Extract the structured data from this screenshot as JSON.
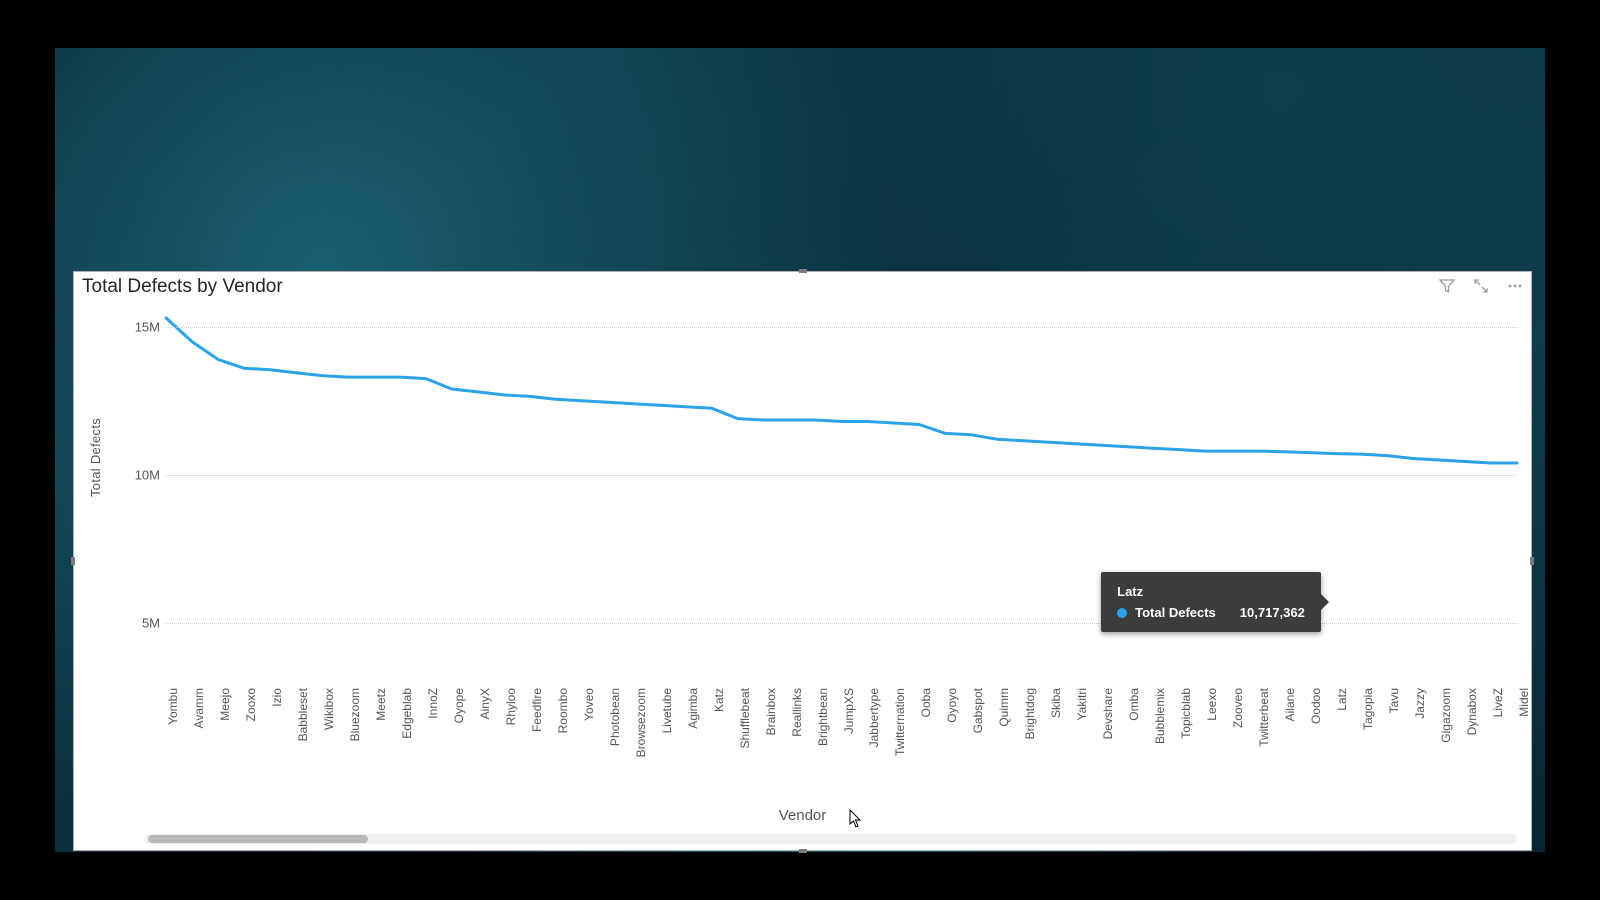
{
  "chart_data": {
    "type": "line",
    "title": "Total Defects by Vendor",
    "xlabel": "Vendor",
    "ylabel": "Total Defects",
    "ylim": [
      3000000,
      15500000
    ],
    "y_ticks": [
      {
        "value": 5000000,
        "label": "5M"
      },
      {
        "value": 10000000,
        "label": "10M"
      },
      {
        "value": 15000000,
        "label": "15M"
      }
    ],
    "categories": [
      "Yombu",
      "Avamm",
      "Meejo",
      "Zooxo",
      "Izio",
      "Babbleset",
      "Wikibox",
      "Bluezoom",
      "Meetz",
      "Edgeblab",
      "InnoZ",
      "Oyope",
      "AinyX",
      "Rhyloo",
      "Feedfire",
      "Roombo",
      "Yoveo",
      "Photobean",
      "Browsezoom",
      "Livetube",
      "Agimba",
      "Katz",
      "Shufflebeat",
      "Brainbox",
      "Reallinks",
      "Brightbean",
      "JumpXS",
      "Jabbertype",
      "Twitternation",
      "Ooba",
      "Oyoyo",
      "Gabspot",
      "Quimm",
      "Brightdog",
      "Skiba",
      "Yakitri",
      "Devshare",
      "Omba",
      "Bubblemix",
      "Topicblab",
      "Leexo",
      "Zooveo",
      "Twitterbeat",
      "Ailane",
      "Oodoo",
      "Latz",
      "Tagopia",
      "Tavu",
      "Jazzy",
      "Gigazoom",
      "Dynabox",
      "LiveZ",
      "Midel"
    ],
    "values": [
      15300000,
      14500000,
      13900000,
      13600000,
      13550000,
      13450000,
      13350000,
      13300000,
      13300000,
      13300000,
      13250000,
      12900000,
      12800000,
      12700000,
      12650000,
      12550000,
      12500000,
      12450000,
      12400000,
      12350000,
      12300000,
      12250000,
      11900000,
      11850000,
      11850000,
      11850000,
      11800000,
      11800000,
      11750000,
      11700000,
      11400000,
      11350000,
      11200000,
      11150000,
      11100000,
      11050000,
      11000000,
      10950000,
      10900000,
      10850000,
      10800000,
      10800000,
      10800000,
      10780000,
      10750000,
      10717362,
      10700000,
      10650000,
      10550000,
      10500000,
      10450000,
      10400000,
      10400000
    ],
    "series_name": "Total Defects"
  },
  "tooltip": {
    "category": "Latz",
    "series": "Total Defects",
    "value_label": "10,717,362",
    "accent": "#2aa3e8"
  },
  "icons": {
    "filter": "filter-icon",
    "focus": "focus-mode-icon",
    "more": "more-options-icon"
  }
}
